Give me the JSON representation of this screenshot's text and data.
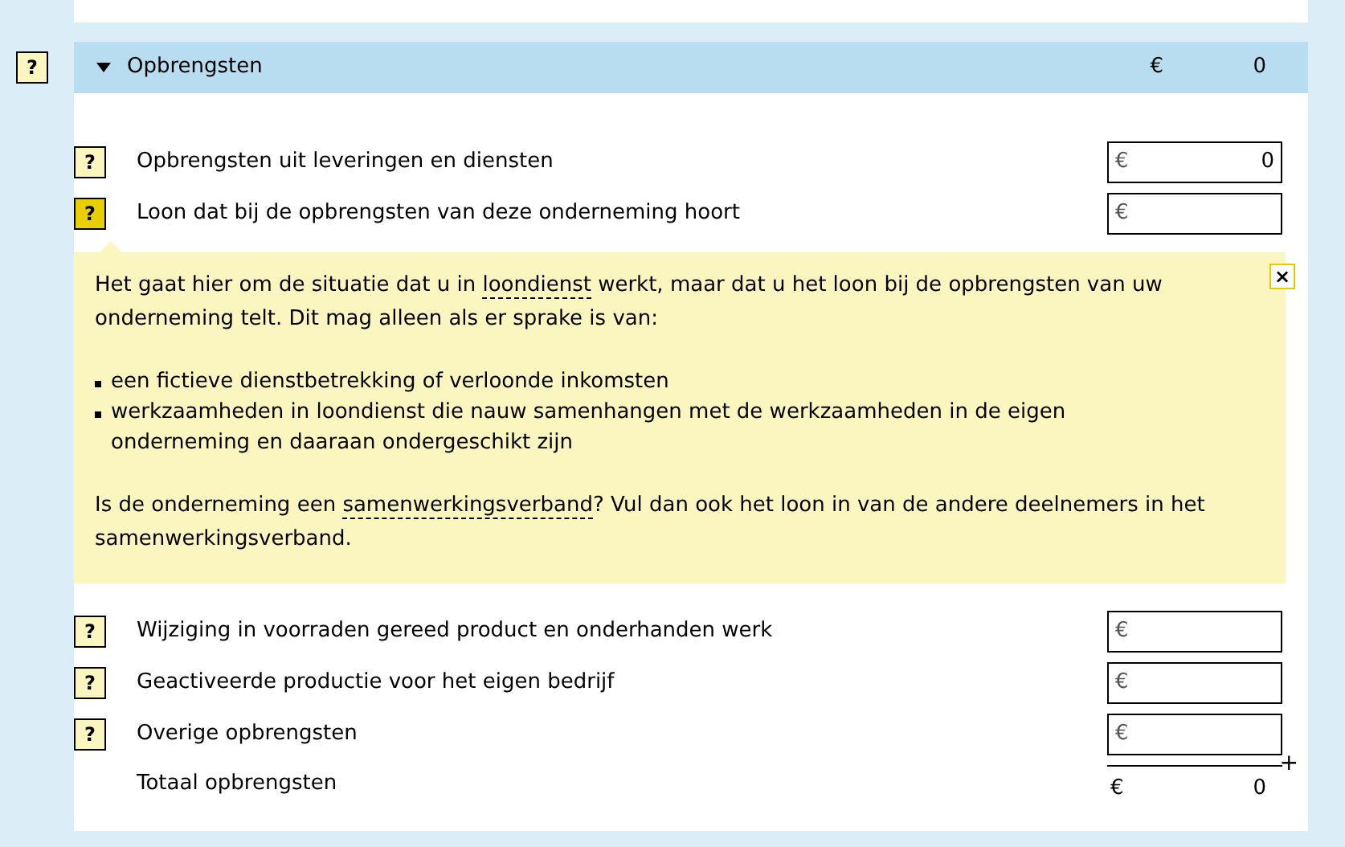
{
  "section": {
    "help_label": "?",
    "title": "Opbrengsten",
    "expanded": true,
    "help_active": false,
    "currency": "€",
    "total": "0"
  },
  "rows": [
    {
      "help_label": "?",
      "label": "Opbrengsten uit leveringen en diensten",
      "help_active": false,
      "currency": "€",
      "value": "0"
    },
    {
      "help_label": "?",
      "label": "Loon dat bij de opbrengsten van deze onderneming hoort",
      "help_active": true,
      "currency": "€",
      "help": {
        "close": "×",
        "blocks": [
          {
            "kind": "paragraph",
            "segments": [
              {
                "kind": "text",
                "text": "Het gaat hier om de situatie dat u in "
              },
              {
                "kind": "term",
                "text": "loondienst"
              },
              {
                "kind": "text",
                "text": " werkt, maar dat u het loon bij de opbrengsten van uw onderneming telt. Dit mag alleen als er sprake is van:"
              }
            ]
          },
          {
            "kind": "list",
            "items": [
              "een fictieve dienstbetrekking of verloonde inkomsten",
              "werkzaamheden in loondienst die nauw samenhangen met de werkzaamheden in de eigen onderneming en daaraan ondergeschikt zijn"
            ]
          },
          {
            "kind": "paragraph",
            "segments": [
              {
                "kind": "text",
                "text": "Is de onderneming een "
              },
              {
                "kind": "term",
                "text": "samenwerkingsverband"
              },
              {
                "kind": "text",
                "text": "? Vul dan ook het loon in van de andere deelnemers in het samenwerkingsverband."
              }
            ]
          }
        ]
      }
    },
    {
      "help_label": "?",
      "label": "Wijziging in voorraden gereed product en onderhanden werk",
      "help_active": false,
      "currency": "€"
    },
    {
      "help_label": "?",
      "label": "Geactiveerde productie voor het eigen bedrijf",
      "help_active": false,
      "currency": "€"
    },
    {
      "help_label": "?",
      "label": "Overige opbrengsten",
      "help_active": false,
      "currency": "€"
    }
  ],
  "total": {
    "label": "Totaal opbrengsten",
    "operator": "+",
    "currency": "€",
    "value": "0"
  }
}
